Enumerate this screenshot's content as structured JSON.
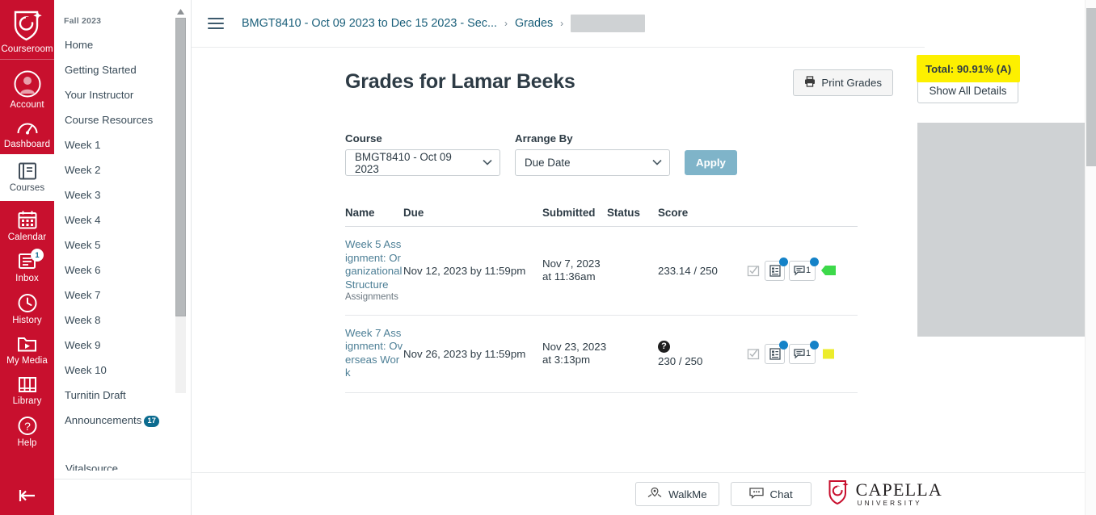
{
  "global_nav": {
    "items": [
      {
        "label": "Courseroom",
        "icon": "shield-logo-icon",
        "badge": null
      },
      {
        "label": "Account",
        "icon": "user-avatar-icon",
        "badge": null
      },
      {
        "label": "Dashboard",
        "icon": "dashboard-gauge-icon",
        "badge": null
      },
      {
        "label": "Courses",
        "icon": "book-icon",
        "badge": null
      },
      {
        "label": "Calendar",
        "icon": "calendar-icon",
        "badge": null
      },
      {
        "label": "Inbox",
        "icon": "inbox-tray-icon",
        "badge": "1"
      },
      {
        "label": "History",
        "icon": "clock-icon",
        "badge": null
      },
      {
        "label": "My Media",
        "icon": "media-folder-play-icon",
        "badge": null
      },
      {
        "label": "Library",
        "icon": "library-books-icon",
        "badge": null
      },
      {
        "label": "Help",
        "icon": "question-circle-icon",
        "badge": null
      }
    ],
    "collapse_icon": "collapse-left-arrow-icon"
  },
  "course_nav": {
    "term": "Fall 2023",
    "items": [
      {
        "label": "Home",
        "badge": null
      },
      {
        "label": "Getting Started",
        "badge": null
      },
      {
        "label": "Your Instructor",
        "badge": null
      },
      {
        "label": "Course Resources",
        "badge": null
      },
      {
        "label": "Week 1",
        "badge": null
      },
      {
        "label": "Week 2",
        "badge": null
      },
      {
        "label": "Week 3",
        "badge": null
      },
      {
        "label": "Week 4",
        "badge": null
      },
      {
        "label": "Week 5",
        "badge": null
      },
      {
        "label": "Week 6",
        "badge": null
      },
      {
        "label": "Week 7",
        "badge": null
      },
      {
        "label": "Week 8",
        "badge": null
      },
      {
        "label": "Week 9",
        "badge": null
      },
      {
        "label": "Week 10",
        "badge": null
      },
      {
        "label": "Turnitin Draft",
        "badge": null
      },
      {
        "label": "Announcements",
        "badge": "17"
      }
    ],
    "cut_off_item": "Vitalsource"
  },
  "breadcrumb": {
    "menu_icon": "hamburger-menu-icon",
    "course": "BMGT8410 - Oct 09 2023 to Dec 15 2023 - Sec...",
    "section": "Grades",
    "separator": "›",
    "redacted": ""
  },
  "main": {
    "title": "Grades for Lamar Beeks",
    "print_label": "Print Grades",
    "print_icon": "printer-icon"
  },
  "filters": {
    "course_label": "Course",
    "course_value": "BMGT8410 - Oct 09 2023",
    "arrange_label": "Arrange By",
    "arrange_value": "Due Date",
    "apply_label": "Apply",
    "chevron_icon": "chevron-down-icon"
  },
  "table": {
    "headers": [
      "Name",
      "Due",
      "Submitted",
      "Status",
      "Score",
      ""
    ],
    "rows": [
      {
        "name": "Week 5 Assignment: Organizational Structure",
        "group": "Assignments",
        "due": "Nov 12, 2023 by 11:59pm",
        "submitted": "Nov 7, 2023 at 11:36am",
        "status": "",
        "status_icon": null,
        "score": "233.14 / 250",
        "comment_count": "1",
        "trend_color": "#3dd94a",
        "icons": [
          "due-date-check-icon",
          "rubric-icon",
          "comment-icon"
        ]
      },
      {
        "name": "Week 7 Assignment: Overseas Work",
        "group": "",
        "due": "Nov 26, 2023 by 11:59pm",
        "submitted": "Nov 23, 2023 at 3:13pm",
        "status": "",
        "status_icon": "question-circle-icon",
        "score": "230 / 250",
        "comment_count": "1",
        "trend_color": "#ecec2b",
        "icons": [
          "due-date-check-icon",
          "rubric-icon",
          "comment-icon"
        ]
      }
    ]
  },
  "rail": {
    "total": "Total: 90.91% (A)",
    "total_highlight_color": "#fdf000",
    "show_details_label": "Show All Details"
  },
  "footer": {
    "walkme_label": "WalkMe",
    "walkme_icon": "walkme-pin-icon",
    "chat_label": "Chat",
    "chat_icon": "chat-bubble-icon",
    "logo_name": "CAPELLA",
    "logo_sub": "UNIVERSITY",
    "logo_icon": "capella-shield-icon"
  }
}
